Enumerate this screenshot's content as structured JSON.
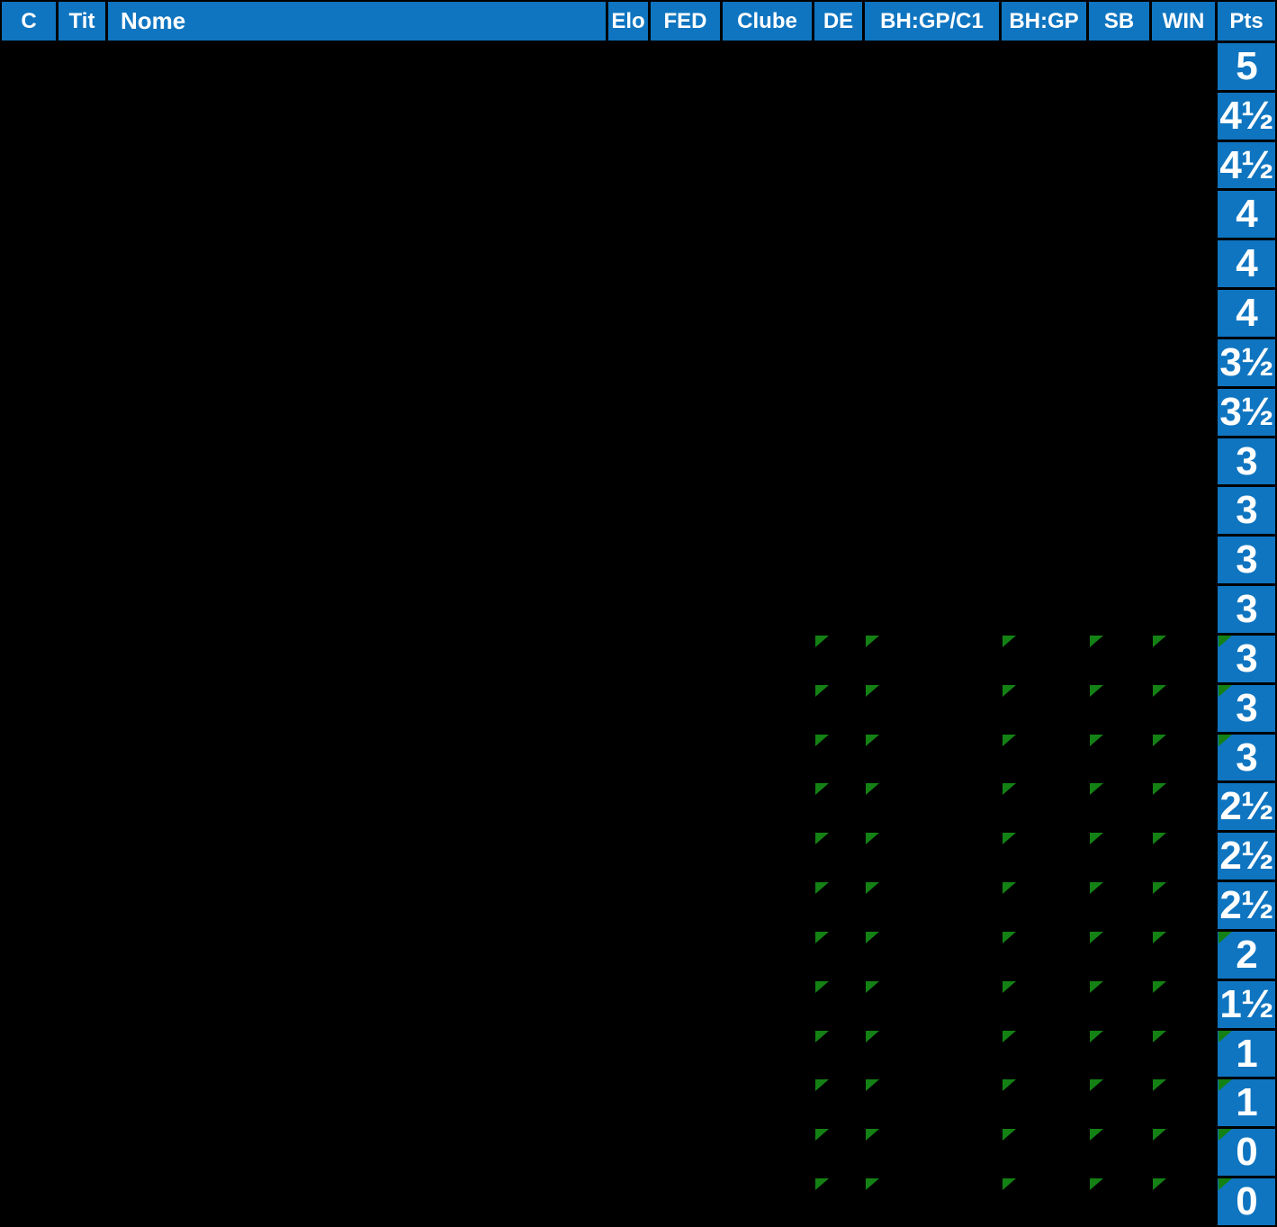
{
  "colors": {
    "background": "#000000",
    "header_bg": "#0F75C0",
    "pts_bg": "#0F75C0",
    "text": "#FFFFFF",
    "marker_green": "#148114"
  },
  "table": {
    "columns": [
      "C",
      "Tit",
      "Nome",
      "Elo",
      "FED",
      "Clube",
      "DE",
      "BH:GP/C1",
      "BH:GP",
      "SB",
      "WIN",
      "Pts"
    ],
    "marker_columns": [
      "DE",
      "BH:GP/C1",
      "BH:GP",
      "SB",
      "WIN"
    ],
    "marker_icon": "green-corner-triangle",
    "rows": [
      {
        "pts": "5",
        "pts_marker": false,
        "row_markers": false
      },
      {
        "pts": "4½",
        "pts_marker": false,
        "row_markers": false
      },
      {
        "pts": "4½",
        "pts_marker": false,
        "row_markers": false
      },
      {
        "pts": "4",
        "pts_marker": false,
        "row_markers": false
      },
      {
        "pts": "4",
        "pts_marker": false,
        "row_markers": false
      },
      {
        "pts": "4",
        "pts_marker": false,
        "row_markers": false
      },
      {
        "pts": "3½",
        "pts_marker": false,
        "row_markers": false
      },
      {
        "pts": "3½",
        "pts_marker": false,
        "row_markers": false
      },
      {
        "pts": "3",
        "pts_marker": false,
        "row_markers": false
      },
      {
        "pts": "3",
        "pts_marker": false,
        "row_markers": false
      },
      {
        "pts": "3",
        "pts_marker": false,
        "row_markers": false
      },
      {
        "pts": "3",
        "pts_marker": false,
        "row_markers": false
      },
      {
        "pts": "3",
        "pts_marker": true,
        "row_markers": true
      },
      {
        "pts": "3",
        "pts_marker": true,
        "row_markers": true
      },
      {
        "pts": "3",
        "pts_marker": true,
        "row_markers": true
      },
      {
        "pts": "2½",
        "pts_marker": false,
        "row_markers": true
      },
      {
        "pts": "2½",
        "pts_marker": false,
        "row_markers": true
      },
      {
        "pts": "2½",
        "pts_marker": false,
        "row_markers": true
      },
      {
        "pts": "2",
        "pts_marker": true,
        "row_markers": true
      },
      {
        "pts": "1½",
        "pts_marker": false,
        "row_markers": true
      },
      {
        "pts": "1",
        "pts_marker": true,
        "row_markers": true
      },
      {
        "pts": "1",
        "pts_marker": true,
        "row_markers": true
      },
      {
        "pts": "0",
        "pts_marker": true,
        "row_markers": true
      },
      {
        "pts": "0",
        "pts_marker": true,
        "row_markers": true
      }
    ]
  }
}
